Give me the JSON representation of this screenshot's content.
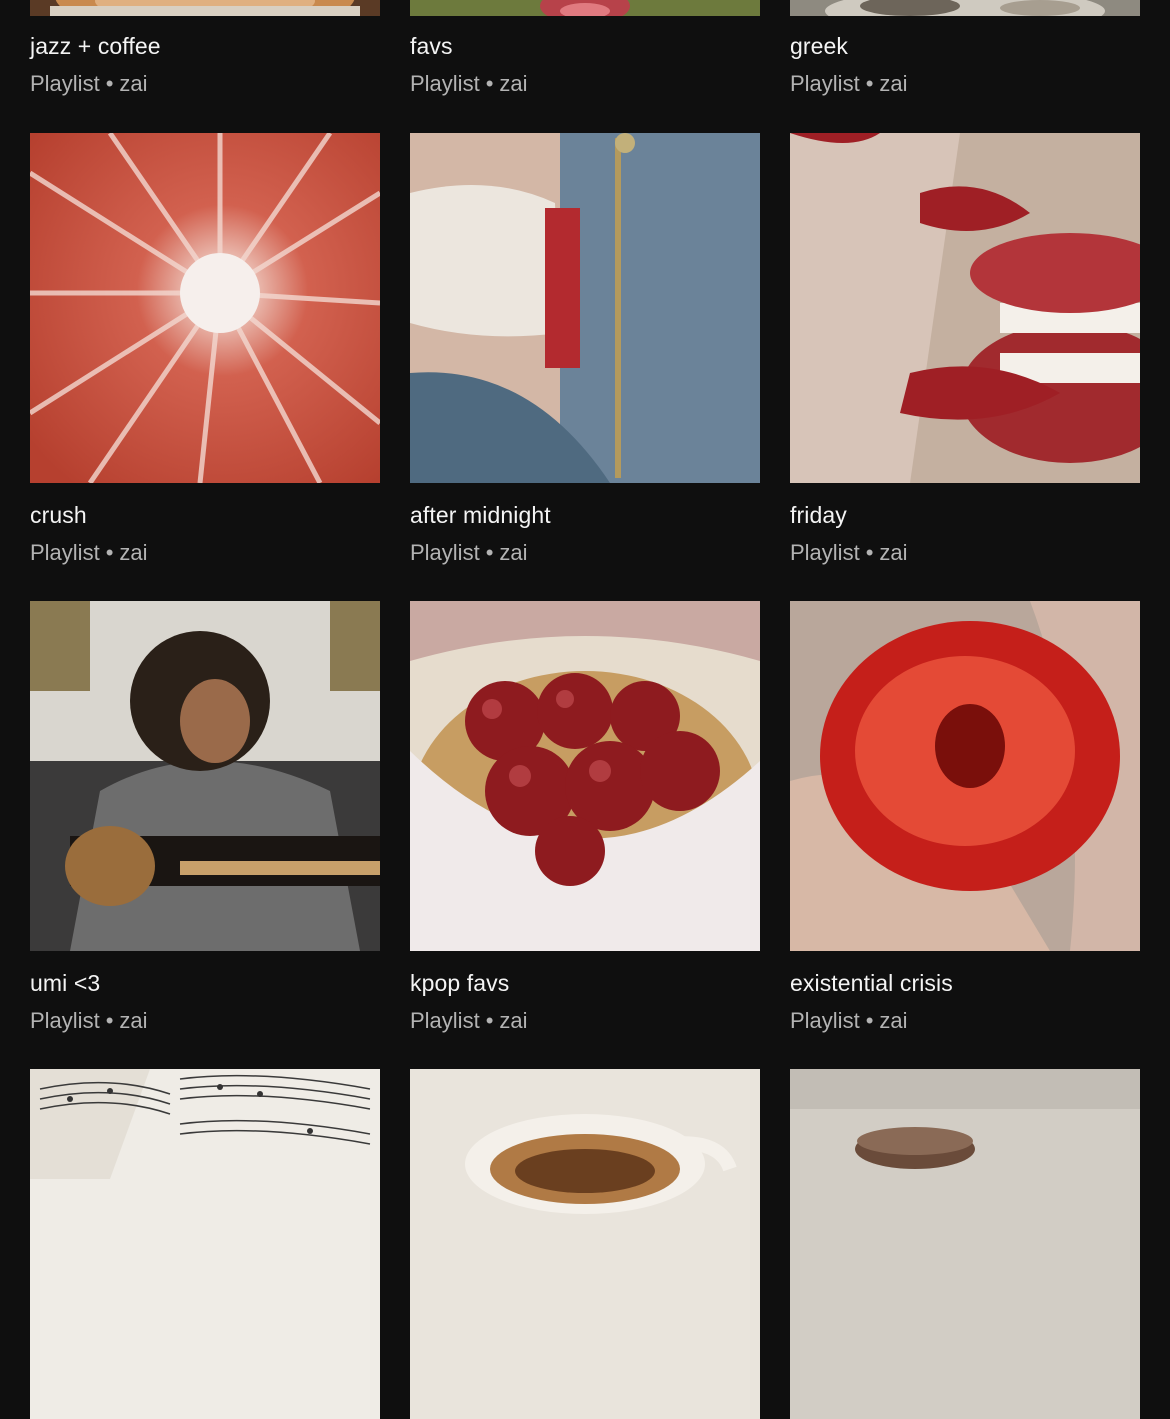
{
  "playlists": [
    {
      "title": "jazz + coffee",
      "type": "Playlist",
      "owner": "zai",
      "cover_icon": "latte-cup-art"
    },
    {
      "title": "favs",
      "type": "Playlist",
      "owner": "zai",
      "cover_icon": "red-lips-art"
    },
    {
      "title": "greek",
      "type": "Playlist",
      "owner": "zai",
      "cover_icon": "silver-dish-art"
    },
    {
      "title": "crush",
      "type": "Playlist",
      "owner": "zai",
      "cover_icon": "grapefruit-slice-art"
    },
    {
      "title": "after midnight",
      "type": "Playlist",
      "owner": "zai",
      "cover_icon": "denim-jeans-art"
    },
    {
      "title": "friday",
      "type": "Playlist",
      "owner": "zai",
      "cover_icon": "red-nails-lips-art"
    },
    {
      "title": "umi <3",
      "type": "Playlist",
      "owner": "zai",
      "cover_icon": "girl-with-bass-guitar-art"
    },
    {
      "title": "kpop favs",
      "type": "Playlist",
      "owner": "zai",
      "cover_icon": "apple-basket-art"
    },
    {
      "title": "existential crisis",
      "type": "Playlist",
      "owner": "zai",
      "cover_icon": "strawberry-art"
    },
    {
      "cover_icon": "sheet-music-art"
    },
    {
      "cover_icon": "coffee-cup-art"
    },
    {
      "cover_icon": "macaron-art"
    }
  ],
  "separator": "•",
  "colors": {
    "background": "#0f0f0f",
    "title": "#f4f4f4",
    "subtitle": "#b3b3b3"
  }
}
